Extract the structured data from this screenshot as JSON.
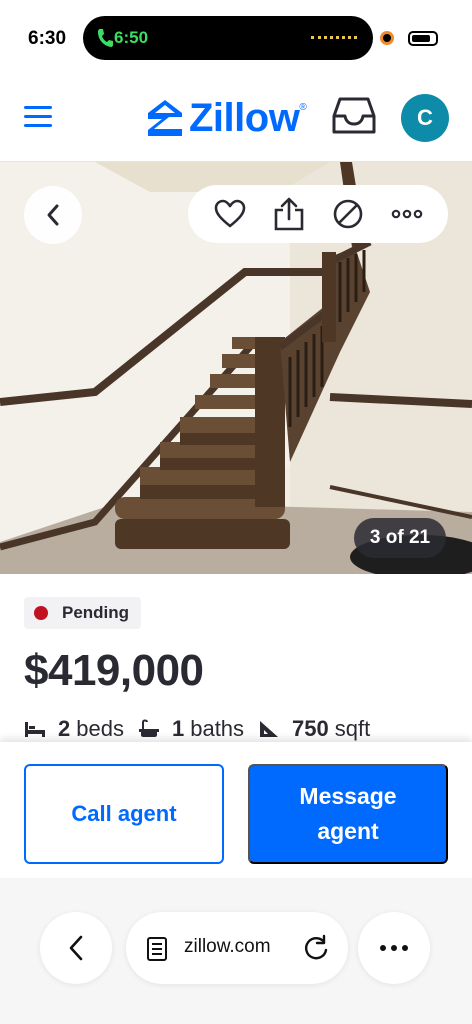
{
  "status_bar": {
    "time": "6:30",
    "call_time": "6:50"
  },
  "header": {
    "logo_text": "Zillow",
    "logo_mark": "®",
    "avatar_initial": "C",
    "icons": [
      "menu-icon",
      "zillow-logo-icon",
      "inbox-icon"
    ]
  },
  "photo": {
    "counter": "3 of 21",
    "actions": [
      "heart-icon",
      "share-icon",
      "hide-icon",
      "more-icon"
    ]
  },
  "listing": {
    "status": "Pending",
    "status_color": "#c1121f",
    "price": "$419,000",
    "beds_num": "2",
    "beds_label": "beds",
    "baths_num": "1",
    "baths_label": "baths",
    "sqft_num": "750",
    "sqft_label": "sqft"
  },
  "cta": {
    "call_label": "Call agent",
    "message_label": "Message agent"
  },
  "browser": {
    "url": "zillow.com",
    "icons": [
      "back-arrow-icon",
      "reader-icon",
      "reload-icon",
      "ellipsis-icon"
    ]
  },
  "colors": {
    "brand": "#006aff",
    "text": "#2a2a33",
    "avatar": "#0d8ba8"
  }
}
